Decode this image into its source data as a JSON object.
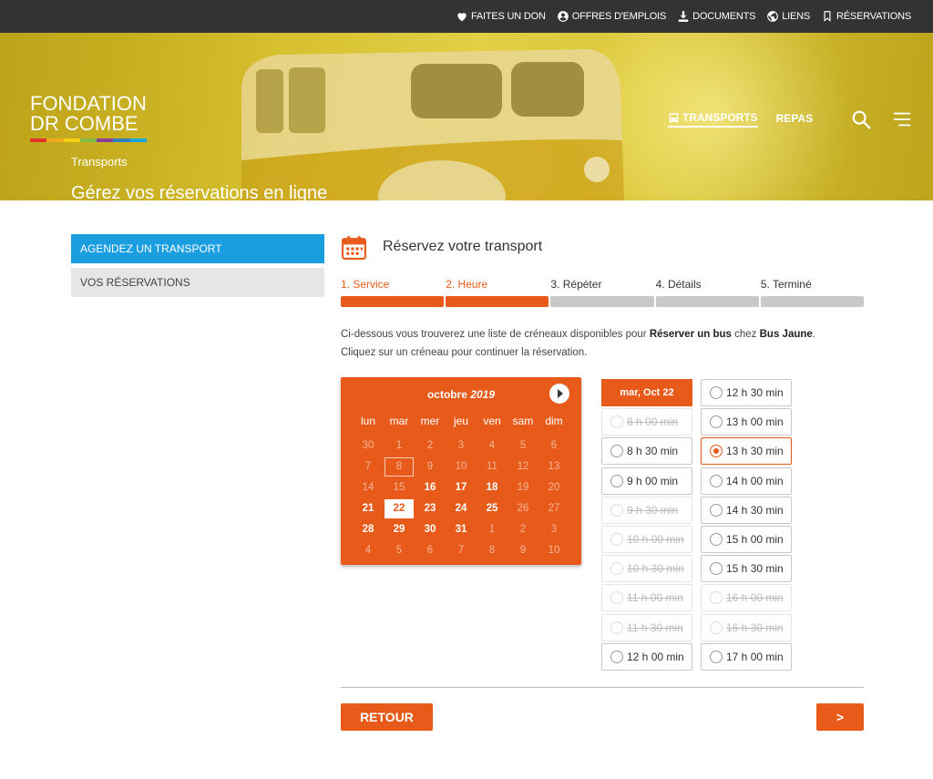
{
  "topbar": {
    "links": [
      {
        "label": "FAITES UN DON",
        "icon": "heart-icon"
      },
      {
        "label": "OFFRES D'EMPLOIS",
        "icon": "user-circle-icon"
      },
      {
        "label": "DOCUMENTS",
        "icon": "download-icon"
      },
      {
        "label": "LIENS",
        "icon": "globe-icon"
      },
      {
        "label": "RÉSERVATIONS",
        "icon": "bookmark-icon"
      }
    ]
  },
  "hero": {
    "logo_line1": "FONDATION",
    "logo_line2": "DR COMBE",
    "logo_colors": [
      "#e63329",
      "#f0a81c",
      "#f4d216",
      "#7dbb42",
      "#8a3f9b",
      "#2f7fc2",
      "#1aa6d8"
    ],
    "breadcrumb": "Transports",
    "title": "Gérez vos réservations en ligne",
    "nav": [
      {
        "label": "TRANSPORTS",
        "icon": "bus-icon",
        "active": true
      },
      {
        "label": "REPAS",
        "active": false
      }
    ]
  },
  "sidebar": {
    "items": [
      {
        "label": "AGENDEZ UN TRANSPORT",
        "active": true
      },
      {
        "label": "VOS RÉSERVATIONS",
        "active": false
      }
    ]
  },
  "main": {
    "title": "Réservez votre transport",
    "steps": [
      {
        "label": "1. Service",
        "done": true
      },
      {
        "label": "2. Heure",
        "done": true
      },
      {
        "label": "3. Répéter",
        "done": false
      },
      {
        "label": "4. Détails",
        "done": false
      },
      {
        "label": "5. Terminé",
        "done": false
      }
    ],
    "desc_1": "Ci-dessous vous trouverez une liste de créneaux disponibles pour ",
    "desc_service": "Réserver un bus",
    "desc_2": " chez ",
    "desc_provider": "Bus Jaune",
    "desc_3": ".",
    "desc_line2": "Cliquez sur un créneau pour continuer la réservation."
  },
  "calendar": {
    "month": "octobre",
    "year": "2019",
    "weekdays": [
      "lun",
      "mar",
      "mer",
      "jeu",
      "ven",
      "sam",
      "dim"
    ],
    "days": [
      [
        "30",
        "other"
      ],
      [
        "1",
        "other"
      ],
      [
        "2",
        "other"
      ],
      [
        "3",
        "other"
      ],
      [
        "4",
        "other"
      ],
      [
        "5",
        "other"
      ],
      [
        "6",
        "other"
      ],
      [
        "7",
        "other"
      ],
      [
        "8",
        "today"
      ],
      [
        "9",
        "other"
      ],
      [
        "10",
        "other"
      ],
      [
        "11",
        "other"
      ],
      [
        "12",
        "other"
      ],
      [
        "13",
        "other"
      ],
      [
        "14",
        "other"
      ],
      [
        "15",
        "other"
      ],
      [
        "16",
        "av"
      ],
      [
        "17",
        "av"
      ],
      [
        "18",
        "av"
      ],
      [
        "19",
        "other"
      ],
      [
        "20",
        "other"
      ],
      [
        "21",
        "av"
      ],
      [
        "22",
        "sel"
      ],
      [
        "23",
        "av"
      ],
      [
        "24",
        "av"
      ],
      [
        "25",
        "av"
      ],
      [
        "26",
        "other"
      ],
      [
        "27",
        "other"
      ],
      [
        "28",
        "av"
      ],
      [
        "29",
        "av"
      ],
      [
        "30",
        "av"
      ],
      [
        "31",
        "av"
      ],
      [
        "1",
        "other"
      ],
      [
        "2",
        "other"
      ],
      [
        "3",
        "other"
      ],
      [
        "4",
        "other"
      ],
      [
        "5",
        "other"
      ],
      [
        "6",
        "other"
      ],
      [
        "7",
        "other"
      ],
      [
        "8",
        "other"
      ],
      [
        "9",
        "other"
      ],
      [
        "10",
        "other"
      ]
    ]
  },
  "slots": {
    "day_label": "mar, Oct 22",
    "col1": [
      {
        "time": "8 h 00 min",
        "state": "dis"
      },
      {
        "time": "8 h 30 min",
        "state": "av"
      },
      {
        "time": "9 h 00 min",
        "state": "av"
      },
      {
        "time": "9 h 30 min",
        "state": "dis"
      },
      {
        "time": "10 h 00 min",
        "state": "dis"
      },
      {
        "time": "10 h 30 min",
        "state": "dis"
      },
      {
        "time": "11 h 00 min",
        "state": "dis"
      },
      {
        "time": "11 h 30 min",
        "state": "dis"
      },
      {
        "time": "12 h 00 min",
        "state": "av"
      }
    ],
    "col2": [
      {
        "time": "12 h 30 min",
        "state": "av"
      },
      {
        "time": "13 h 00 min",
        "state": "av"
      },
      {
        "time": "13 h 30 min",
        "state": "sel"
      },
      {
        "time": "14 h 00 min",
        "state": "av"
      },
      {
        "time": "14 h 30 min",
        "state": "av"
      },
      {
        "time": "15 h 00 min",
        "state": "av"
      },
      {
        "time": "15 h 30 min",
        "state": "av"
      },
      {
        "time": "16 h 00 min",
        "state": "dis"
      },
      {
        "time": "16 h 30 min",
        "state": "dis"
      },
      {
        "time": "17 h 00 min",
        "state": "av"
      }
    ]
  },
  "footer": {
    "back_label": "RETOUR",
    "next_label": ">"
  },
  "colors": {
    "accent": "#e85a1a",
    "sidebar_active": "#1a9ee0",
    "topbar": "#333333"
  }
}
